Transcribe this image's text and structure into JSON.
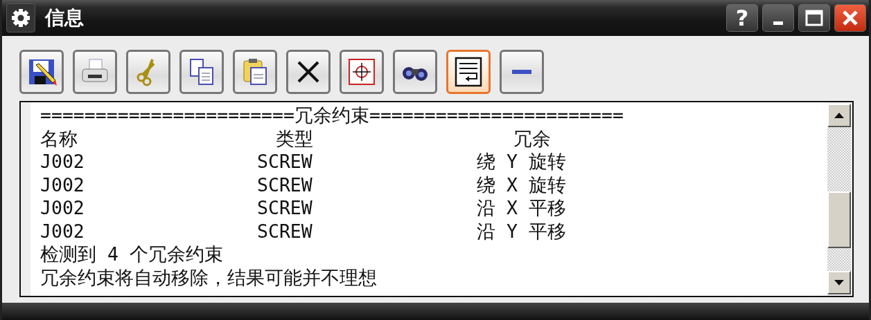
{
  "window": {
    "title": "信息",
    "help_label": "?"
  },
  "toolbar": [
    {
      "kind": "save",
      "on": false
    },
    {
      "kind": "print",
      "on": false
    },
    {
      "kind": "cut",
      "on": false
    },
    {
      "kind": "copy",
      "on": false
    },
    {
      "kind": "paste",
      "on": false
    },
    {
      "kind": "delete",
      "on": false
    },
    {
      "kind": "target",
      "on": false
    },
    {
      "kind": "find",
      "on": false
    },
    {
      "kind": "wrap",
      "on": true
    },
    {
      "kind": "collapse",
      "on": false
    }
  ],
  "output": {
    "separator_left": "=======================",
    "section_title": "冗余约束",
    "separator_right": "=======================",
    "columns": [
      "名称",
      "类型",
      "冗余"
    ],
    "rows": [
      {
        "name": "J002",
        "type": "SCREW",
        "redundancy": "绕 Y 旋转"
      },
      {
        "name": "J002",
        "type": "SCREW",
        "redundancy": "绕 X 旋转"
      },
      {
        "name": "J002",
        "type": "SCREW",
        "redundancy": "沿 X 平移"
      },
      {
        "name": "J002",
        "type": "SCREW",
        "redundancy": "沿 Y 平移"
      }
    ],
    "messages": [
      "检测到 4 个冗余约束",
      "冗余约束将自动移除，结果可能并不理想"
    ]
  }
}
